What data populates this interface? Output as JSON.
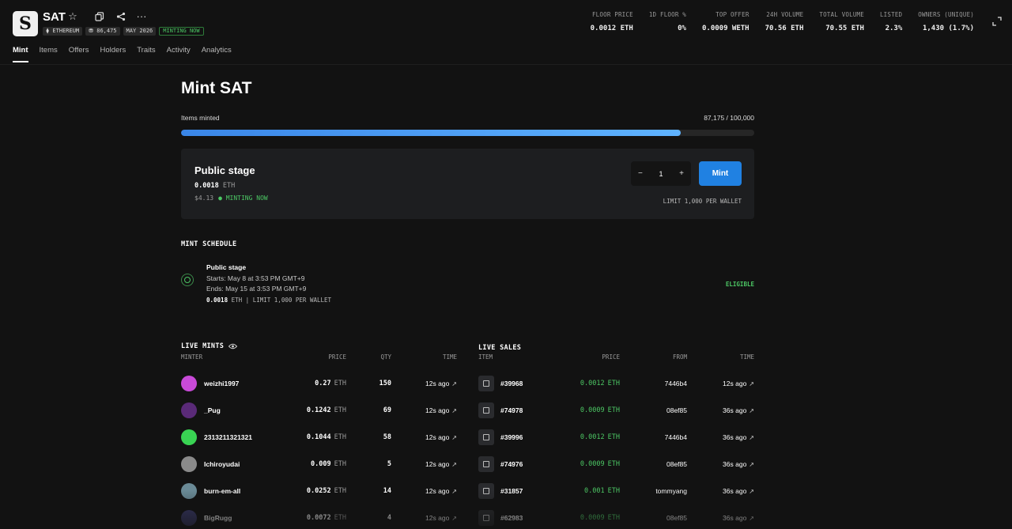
{
  "collection": {
    "title": "SAT",
    "logo_letter": "S",
    "chips": [
      "⧫ ETHEREUM",
      "⛃ 86,475",
      "MAY 2026",
      "MINTING NOW"
    ]
  },
  "stats": [
    {
      "label": "FLOOR PRICE",
      "value": "0.0012 ETH"
    },
    {
      "label": "1D FLOOR %",
      "value": "0%"
    },
    {
      "label": "TOP OFFER",
      "value": "0.0009 WETH"
    },
    {
      "label": "24H VOLUME",
      "value": "70.56 ETH"
    },
    {
      "label": "TOTAL VOLUME",
      "value": "70.55 ETH"
    },
    {
      "label": "LISTED",
      "value": "2.3%"
    },
    {
      "label": "OWNERS (UNIQUE)",
      "value": "1,430 (1.7%)"
    }
  ],
  "tabs": [
    "Mint",
    "Items",
    "Offers",
    "Holders",
    "Traits",
    "Activity",
    "Analytics"
  ],
  "mint": {
    "heading": "Mint SAT",
    "items_minted_label": "Items minted",
    "items_minted_value": "87,175 / 100,000",
    "progress_fraction": 0.87175,
    "stage": {
      "title": "Public stage",
      "price": "0.0018",
      "unit": "ETH",
      "usd": "$4.13",
      "status": "● MINTING NOW",
      "quantity": "1",
      "minus": "−",
      "plus": "+",
      "button": "Mint",
      "limit": "LIMIT 1,000 PER WALLET"
    }
  },
  "schedule": {
    "heading": "MINT SCHEDULE",
    "stage_title": "Public stage",
    "starts": "Starts: May 8 at 3:53 PM GMT+9",
    "ends": "Ends: May 15 at 3:53 PM GMT+9",
    "price": "0.0018",
    "price_rest": " ETH | LIMIT 1,000 PER WALLET",
    "status": "ELIGIBLE"
  },
  "live_mints": {
    "heading": "LIVE MINTS",
    "columns": [
      "MINTER",
      "PRICE",
      "QTY",
      "TIME"
    ],
    "rows": [
      {
        "minter": "weizhi1997",
        "price": "0.27",
        "unit": "ETH",
        "qty": "150",
        "time": "12s ago",
        "arrow": "↗",
        "avatar_color": "#c84ad8"
      },
      {
        "minter": "_Pug",
        "price": "0.1242",
        "unit": "ETH",
        "qty": "69",
        "time": "12s ago",
        "arrow": "↗",
        "avatar_color": "#5a2a78"
      },
      {
        "minter": "2313211321321",
        "price": "0.1044",
        "unit": "ETH",
        "qty": "58",
        "time": "12s ago",
        "arrow": "↗",
        "avatar_color": "#39d353"
      },
      {
        "minter": "Ichiroyudai",
        "price": "0.009",
        "unit": "ETH",
        "qty": "5",
        "time": "12s ago",
        "arrow": "↗",
        "avatar_color": "#8a8a8a"
      },
      {
        "minter": "burn-em-all",
        "price": "0.0252",
        "unit": "ETH",
        "qty": "14",
        "time": "12s ago",
        "arrow": "↗",
        "avatar_color": "#6a8a96"
      },
      {
        "minter": "BigRugg",
        "price": "0.0072",
        "unit": "ETH",
        "qty": "4",
        "time": "12s ago",
        "arrow": "↗",
        "avatar_color": "#3a3a6a"
      }
    ]
  },
  "live_sales": {
    "heading": "LIVE SALES",
    "columns": [
      "ITEM",
      "PRICE",
      "FROM",
      "TIME"
    ],
    "rows": [
      {
        "item": "#39968",
        "price": "0.0012",
        "unit": "ETH",
        "from": "7446b4",
        "time": "12s ago",
        "arrow": "↗"
      },
      {
        "item": "#74978",
        "price": "0.0009",
        "unit": "ETH",
        "from": "08ef85",
        "time": "36s ago",
        "arrow": "↗"
      },
      {
        "item": "#39996",
        "price": "0.0012",
        "unit": "ETH",
        "from": "7446b4",
        "time": "36s ago",
        "arrow": "↗"
      },
      {
        "item": "#74976",
        "price": "0.0009",
        "unit": "ETH",
        "from": "08ef85",
        "time": "36s ago",
        "arrow": "↗"
      },
      {
        "item": "#31857",
        "price": "0.001",
        "unit": "ETH",
        "from": "tommyang",
        "time": "36s ago",
        "arrow": "↗"
      },
      {
        "item": "#62983",
        "price": "0.0009",
        "unit": "ETH",
        "from": "08ef85",
        "time": "36s ago",
        "arrow": "↗"
      }
    ]
  }
}
